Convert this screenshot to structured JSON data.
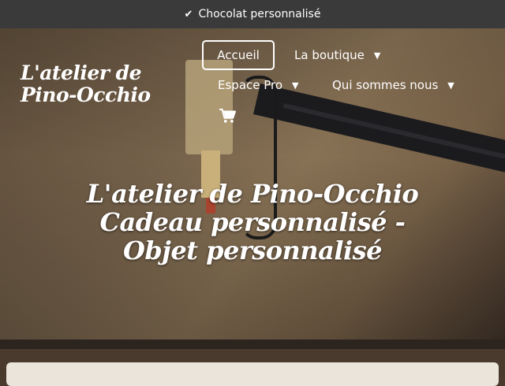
{
  "topbar": {
    "message": "Chocolat personnalisé",
    "icon": "check-icon"
  },
  "site": {
    "logo_text": "L'atelier de Pino-Occhio"
  },
  "nav": {
    "items": [
      {
        "label": "Accueil",
        "active": true
      },
      {
        "label": "La boutique",
        "has_dropdown": true
      },
      {
        "label": "Espace Pro",
        "has_dropdown": true
      },
      {
        "label": "Qui sommes nous",
        "has_dropdown": true
      }
    ],
    "cart_icon": "cart-icon"
  },
  "hero": {
    "title_line1": "L'atelier de Pino-Occhio",
    "title_line2": "Cadeau personnalisé - Objet personnalisé"
  },
  "colors": {
    "topbar_bg": "#3a3a3a",
    "content_bg": "#ebe4da"
  }
}
